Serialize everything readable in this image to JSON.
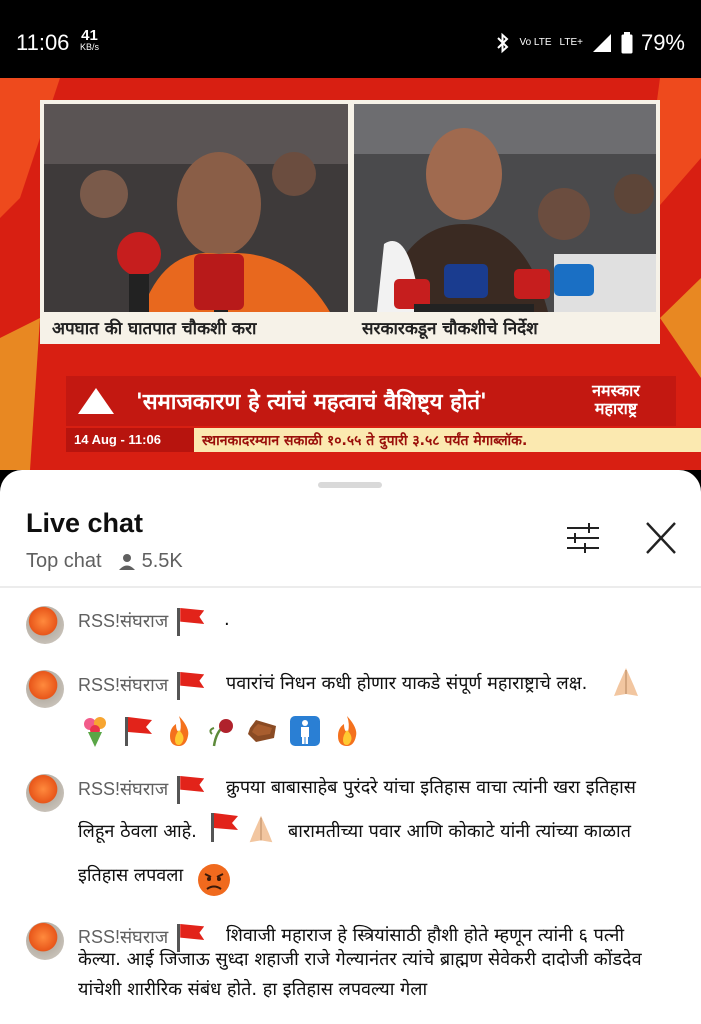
{
  "status_bar": {
    "time": "11:06",
    "speed_value": "41",
    "speed_unit": "KB/s",
    "network": "LTE+",
    "volte": "Vo LTE",
    "battery": "79%"
  },
  "video": {
    "caption_left": "अपघात की घातपात चौकशी करा",
    "caption_right": "सरकारकडून चौकशीचे निर्देश",
    "headline": "'समाजकारण हे त्यांचं महत्वाचं वैशिष्ट्य होतं'",
    "brand_line1": "नमस्कार",
    "brand_line2": "महाराष्ट्र",
    "ticker_time": "14 Aug - 11:06",
    "ticker_text": "स्थानकादरम्यान सकाळी १०.५५ ते दुपारी ३.५८ पर्यंत मेगाब्लॉक."
  },
  "chat": {
    "title": "Live chat",
    "mode": "Top chat",
    "viewers": "5.5K",
    "messages": [
      {
        "author": "RSS!संघराज",
        "text": "."
      },
      {
        "author": "RSS!संघराज",
        "text": "पवारांचं निधन कधी होणार याकडे संपूर्ण महाराष्ट्राचे लक्ष."
      },
      {
        "author": "RSS!संघराज",
        "line1": "क्रुपया बाबासाहेब पुरंदरे यांचा इतिहास वाचा त्यांनी खरा इतिहास",
        "line2a": "लिहून ठेवला आहे.",
        "line2b": "बारामतीच्या पवार आणि कोकाटे यांनी त्यांच्या काळात",
        "line3": "इतिहास लपवला"
      },
      {
        "author": "RSS!संघराज",
        "line1": "शिवाजी महाराज हे स्त्रियांसाठी हौशी होते म्हणून त्यांनी ६ पत्नी",
        "line2": "केल्या. आई जिजाऊ सुध्दा शहाजी राजे गेल्यानंतर त्यांचे ब्राह्मण सेवेकरी दादोजी कोंडदेव",
        "line3": "यांचेशी शारीरिक संबंध होते. हा इतिहास लपवल्या गेला"
      }
    ]
  },
  "icons": {
    "filter": "sliders-icon",
    "close": "close-icon",
    "viewer": "person-icon",
    "flag": "red-flag-icon"
  }
}
